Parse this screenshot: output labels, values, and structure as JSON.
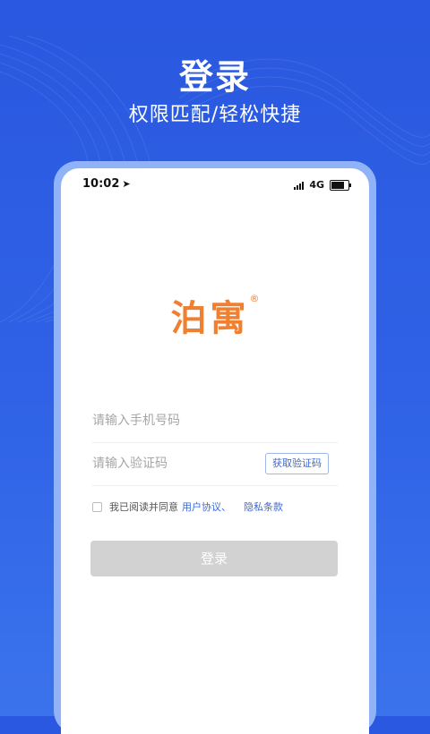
{
  "header": {
    "title": "登录",
    "subtitle": "权限匹配/轻松快捷"
  },
  "statusbar": {
    "time": "10:02",
    "location_icon": "location-arrow-icon",
    "network": "4G",
    "battery_level": 0.8
  },
  "logo": {
    "text": "泊寓",
    "mark": "®"
  },
  "form": {
    "phone_placeholder": "请输入手机号码",
    "code_placeholder": "请输入验证码",
    "get_code_label": "获取验证码",
    "agree_text": "我已阅读并同意",
    "user_agreement": "用户协议、",
    "privacy_policy": "隐私条款",
    "agree_checked": false,
    "login_label": "登录"
  },
  "colors": {
    "background": "#2f62e6",
    "brand": "#ef7f31",
    "link": "#3a6ad8",
    "button_disabled": "#d2d2d2"
  }
}
